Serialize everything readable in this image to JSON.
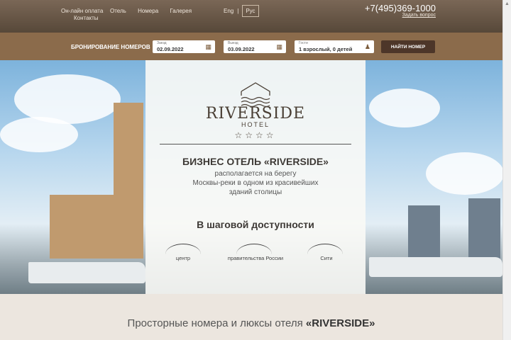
{
  "header": {
    "nav": [
      "Он-лайн оплата",
      "Отель",
      "Номера",
      "Галерея",
      "Контакты"
    ],
    "lang_en": "Eng",
    "lang_sep": "|",
    "lang_ru": "Рус",
    "phone": "+7(495)369-1000",
    "ask": "Задать вопрос"
  },
  "booking": {
    "title": "БРОНИРОВАНИЕ НОМЕРОВ",
    "checkin_label": "Заезд",
    "checkin": "02.09.2022",
    "checkout_label": "Выезд",
    "checkout": "03.09.2022",
    "guests_label": "Гости",
    "guests": "1 взрослый, 0 детей",
    "find": "НАЙТИ НОМЕР"
  },
  "hero": {
    "logo_name": "RIVERSIDE",
    "logo_sub": "HOTEL",
    "stars": "☆☆☆☆",
    "title": "БИЗНЕС ОТЕЛЬ «RIVERSIDE»",
    "desc1": "располагается на берегу",
    "desc2": "Москвы-реки в одном из красивейших",
    "desc3": "зданий столицы",
    "near_title": "В шаговой доступности",
    "near": [
      "центр",
      "правительства России",
      "Сити"
    ]
  },
  "bottom": {
    "text": "Просторные номера и люксы отеля ",
    "brand": "«RIVERSIDE»"
  }
}
